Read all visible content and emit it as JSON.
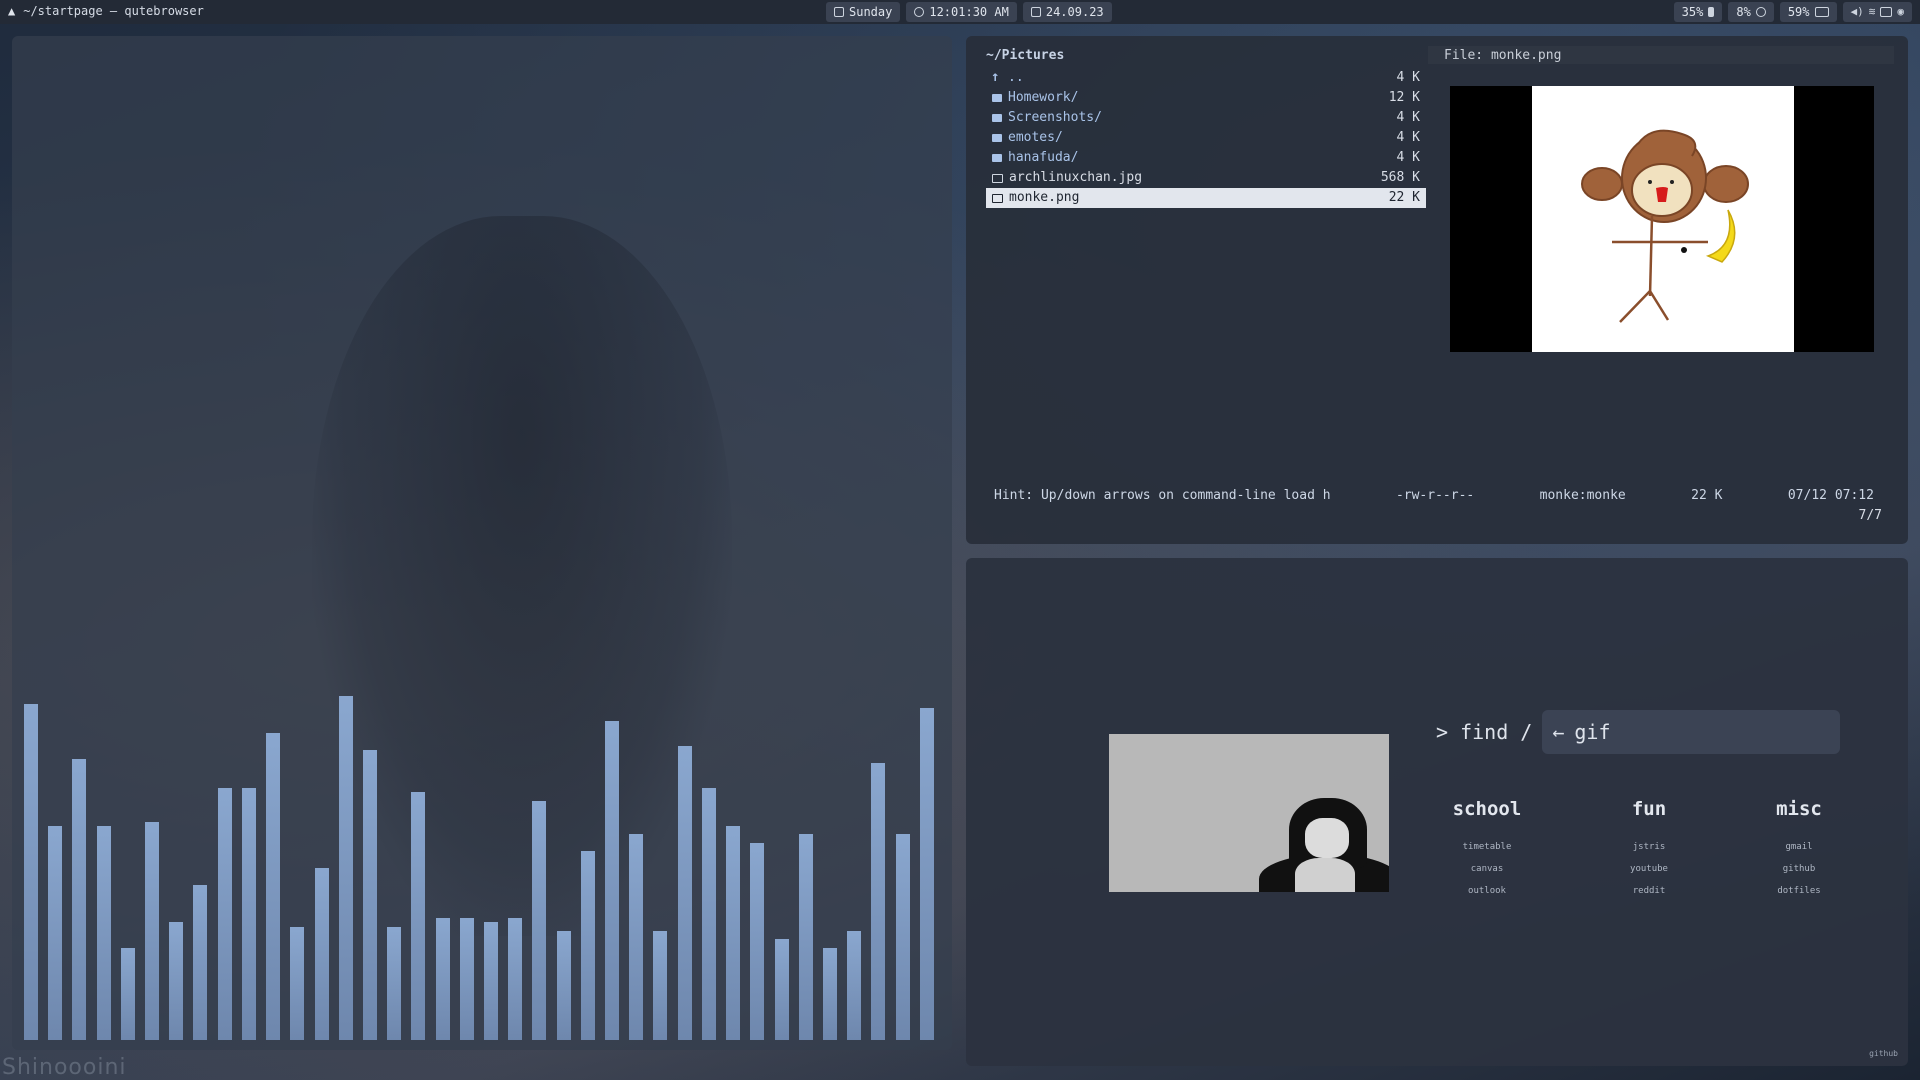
{
  "topbar": {
    "app_icon": "arch-logo",
    "window_title": "~/startpage — qutebrowser",
    "day": "Sunday",
    "time": "12:01:30 AM",
    "date": "24.09.23",
    "cpu": "35%",
    "memory": "8%",
    "battery": "59%",
    "icons": [
      "calendar-icon",
      "clock-icon",
      "date-icon",
      "cpu-icon",
      "memory-icon",
      "battery-icon",
      "volume-icon",
      "wifi-icon",
      "window-icon",
      "gamepad-icon"
    ]
  },
  "visualizer": {
    "levels": [
      0.8,
      0.51,
      0.67,
      0.51,
      0.22,
      0.52,
      0.28,
      0.37,
      0.6,
      0.6,
      0.73,
      0.27,
      0.41,
      0.82,
      0.69,
      0.27,
      0.59,
      0.29,
      0.29,
      0.28,
      0.29,
      0.57,
      0.26,
      0.45,
      0.76,
      0.49,
      0.26,
      0.7,
      0.6,
      0.51,
      0.47,
      0.24,
      0.49,
      0.22,
      0.26,
      0.66,
      0.49,
      0.79
    ],
    "color": "#7f9bc4"
  },
  "watermark": "Shinoooini",
  "file_manager": {
    "path": "~/Pictures",
    "entries": [
      {
        "name": "..",
        "size": "4 K",
        "type": "up"
      },
      {
        "name": "Homework/",
        "size": "12 K",
        "type": "dir"
      },
      {
        "name": "Screenshots/",
        "size": "4 K",
        "type": "dir"
      },
      {
        "name": "emotes/",
        "size": "4 K",
        "type": "dir"
      },
      {
        "name": "hanafuda/",
        "size": "4 K",
        "type": "dir"
      },
      {
        "name": "archlinuxchan.jpg",
        "size": "568 K",
        "type": "file"
      },
      {
        "name": "monke.png",
        "size": "22 K",
        "type": "file",
        "selected": true
      }
    ],
    "preview_label": "File: monke.png",
    "status": {
      "hint": "Hint: Up/down arrows on command-line load h",
      "perms": "-rw-r--r--",
      "owner": "monke:monke",
      "size": "22 K",
      "modified": "07/12 07:12"
    },
    "count": "7/7"
  },
  "startpage": {
    "prompt": "> find /",
    "back_arrow": "←",
    "search_value": "gif",
    "columns": [
      {
        "heading": "school",
        "links": [
          "timetable",
          "canvas",
          "outlook"
        ]
      },
      {
        "heading": "fun",
        "links": [
          "jstris",
          "youtube",
          "reddit"
        ]
      },
      {
        "heading": "misc",
        "links": [
          "gmail",
          "github",
          "dotfiles"
        ]
      }
    ],
    "footer": "github"
  }
}
